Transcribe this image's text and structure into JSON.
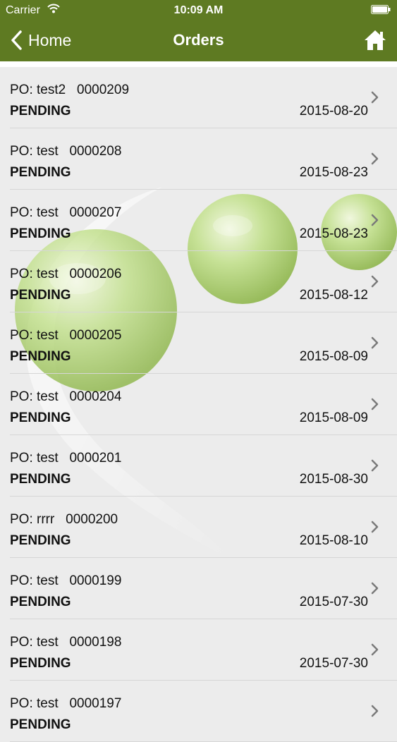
{
  "status_bar": {
    "carrier": "Carrier",
    "time": "10:09 AM"
  },
  "nav": {
    "back_label": "Home",
    "title": "Orders"
  },
  "colors": {
    "header": "#5e7a22",
    "background": "#ececec",
    "accent": "#a8cc62"
  },
  "icons": [
    "wifi-icon",
    "battery-icon",
    "back-chevron-icon",
    "home-icon",
    "chevron-right-icon"
  ],
  "orders": [
    {
      "po": "PO: test2   0000209",
      "status": "PENDING",
      "date": "2015-08-20"
    },
    {
      "po": "PO: test   0000208",
      "status": "PENDING",
      "date": "2015-08-23"
    },
    {
      "po": "PO: test   0000207",
      "status": "PENDING",
      "date": "2015-08-23"
    },
    {
      "po": "PO: test   0000206",
      "status": "PENDING",
      "date": "2015-08-12"
    },
    {
      "po": "PO: test   0000205",
      "status": "PENDING",
      "date": "2015-08-09"
    },
    {
      "po": "PO: test   0000204",
      "status": "PENDING",
      "date": "2015-08-09"
    },
    {
      "po": "PO: test   0000201",
      "status": "PENDING",
      "date": "2015-08-30"
    },
    {
      "po": "PO: rrrr   0000200",
      "status": "PENDING",
      "date": "2015-08-10"
    },
    {
      "po": "PO: test   0000199",
      "status": "PENDING",
      "date": "2015-07-30"
    },
    {
      "po": "PO: test   0000198",
      "status": "PENDING",
      "date": "2015-07-30"
    },
    {
      "po": "PO: test   0000197",
      "status": "PENDING",
      "date": ""
    }
  ]
}
